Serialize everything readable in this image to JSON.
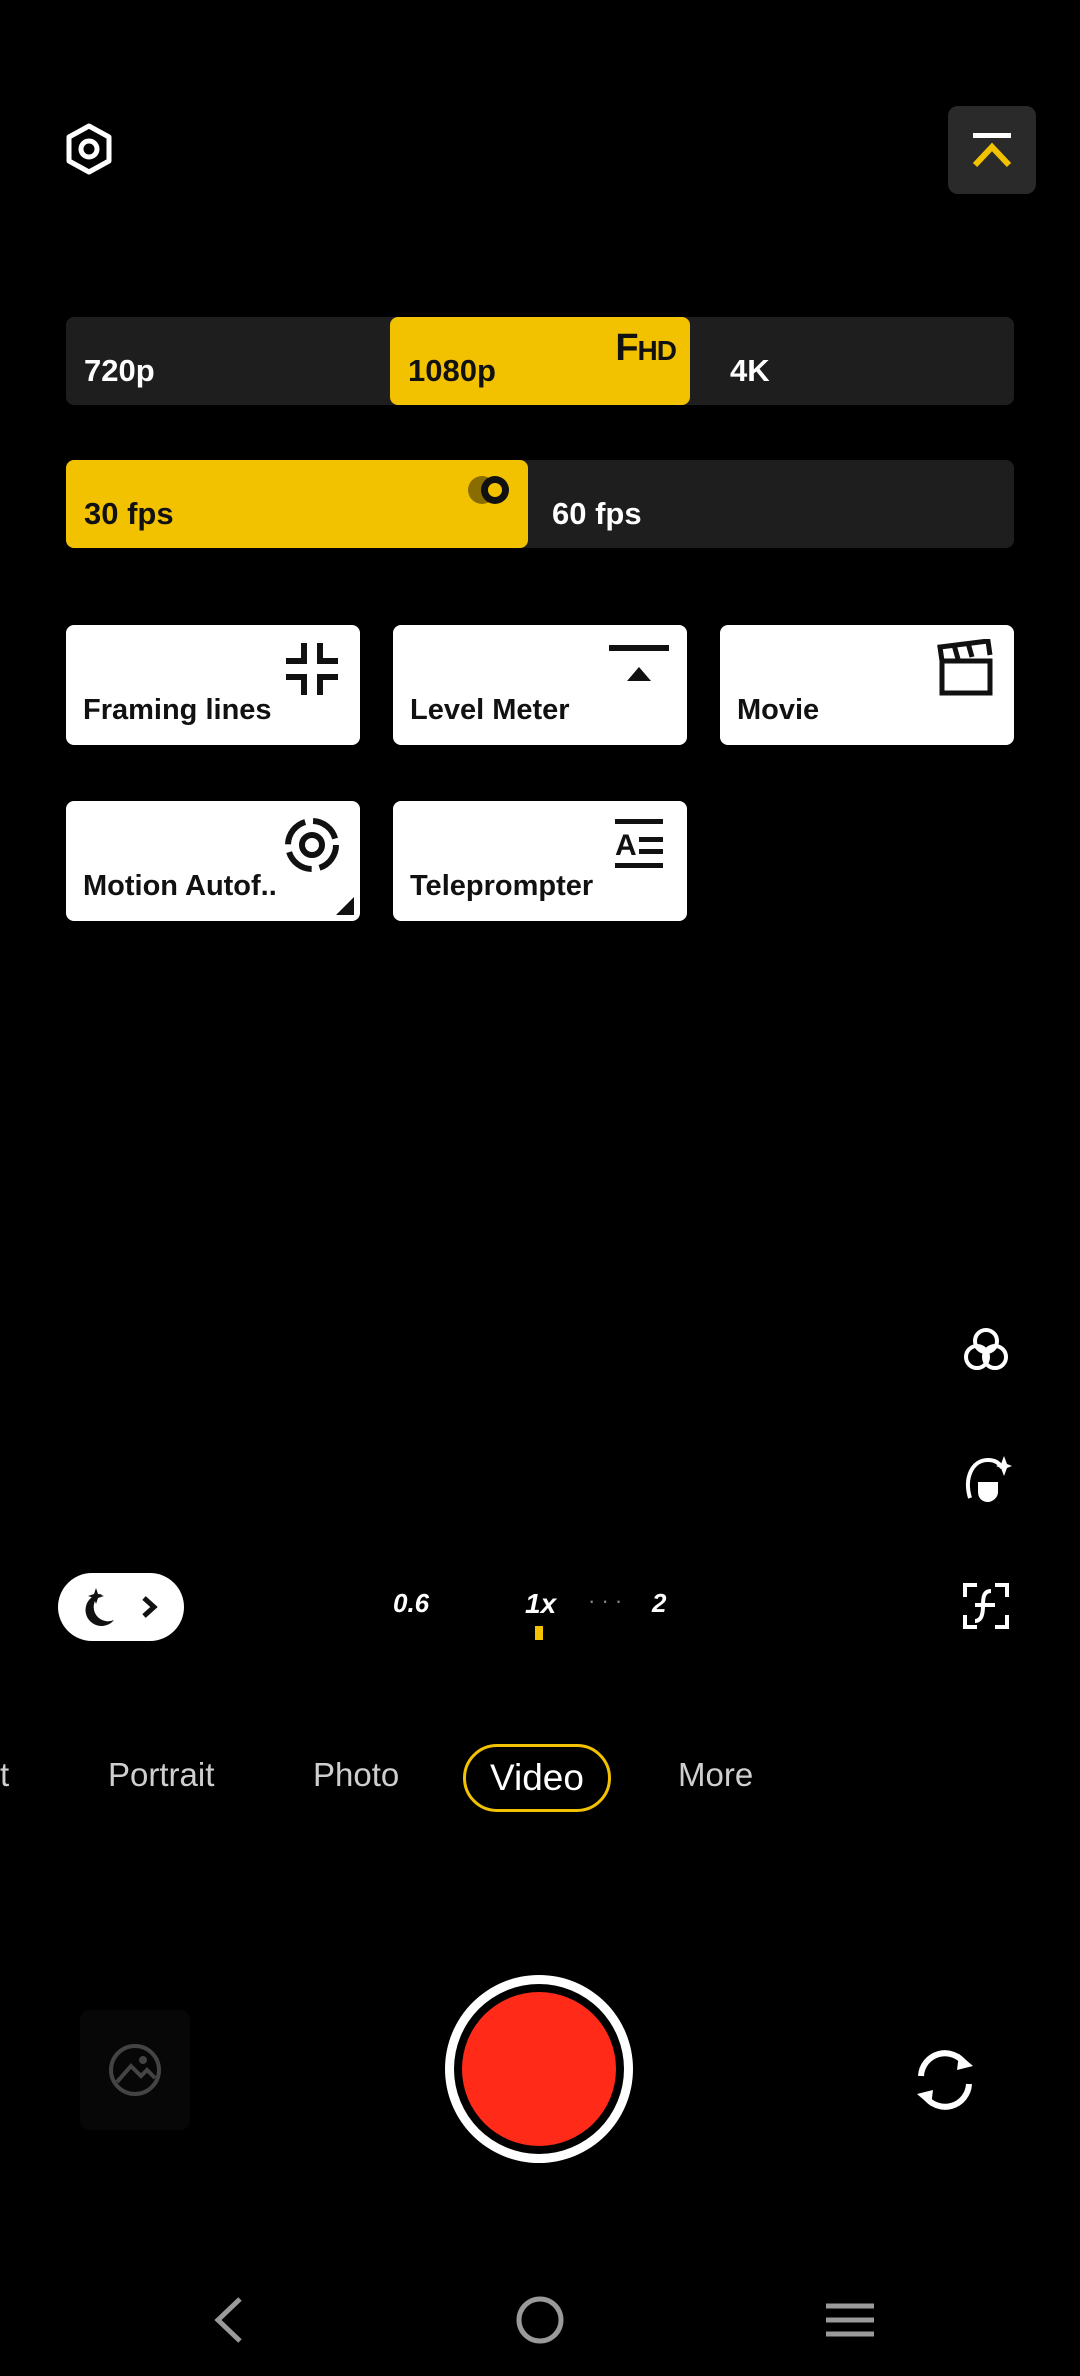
{
  "resolution": {
    "options": [
      {
        "label": "720p",
        "selected": false
      },
      {
        "label": "1080p",
        "selected": true
      },
      {
        "label": "4K",
        "selected": false
      }
    ],
    "badge_main": "F",
    "badge_small": "HD"
  },
  "framerate": {
    "options": [
      {
        "label": "30 fps",
        "selected": true
      },
      {
        "label": "60 fps",
        "selected": false
      }
    ]
  },
  "tiles": [
    {
      "label": "Framing lines",
      "icon": "framing-lines-icon"
    },
    {
      "label": "Level Meter",
      "icon": "level-meter-icon"
    },
    {
      "label": "Movie",
      "icon": "clapperboard-icon"
    },
    {
      "label": "Motion Autof..",
      "icon": "motion-autofocus-icon"
    },
    {
      "label": "Teleprompter",
      "icon": "teleprompter-icon"
    }
  ],
  "zoom": {
    "levels": [
      "0.6",
      "1x",
      "2"
    ],
    "dots": "· · ·"
  },
  "modes": {
    "partial": "t",
    "items": [
      "Portrait",
      "Photo",
      "Video",
      "More"
    ],
    "active": "Video"
  },
  "colors": {
    "accent": "#f2c200",
    "record": "#ff2a17",
    "tile_bg": "#ffffff",
    "segment_bg": "#1e1e1e"
  }
}
